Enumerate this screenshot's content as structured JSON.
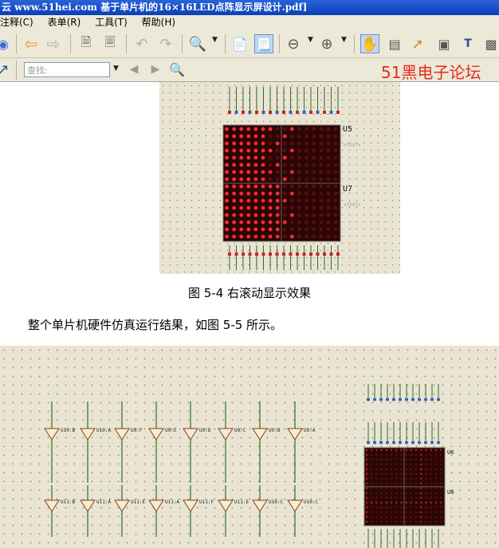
{
  "window": {
    "title": "云 www.51hei.com 基于单片机的16×16LED点阵显示屏设计.pdf]"
  },
  "menu": {
    "items": [
      "注释(C)",
      "表单(R)",
      "工具(T)",
      "帮助(H)"
    ]
  },
  "toolbar2": {
    "search_placeholder": "查找:",
    "brand": "51黑电子论坛"
  },
  "document": {
    "figure1": {
      "u5_label": "U5",
      "u7_label": "U7",
      "text_placeholder": "<TEXT>"
    },
    "caption": "图 5-4  右滚动显示效果",
    "paragraph": "整个单片机硬件仿真运行结果，如图     5-5 所示。",
    "figure2": {
      "inverters_top": [
        "U10:B",
        "U10:A",
        "U9:F",
        "U9:E",
        "U9:D",
        "U9:C",
        "U9:B",
        "U9:A"
      ],
      "inverters_bottom": [
        "U11:B",
        "U11:A",
        "U11:E",
        "U11:A",
        "U11:F",
        "U11:E",
        "U10:C",
        "U10:C"
      ],
      "u6_label": "U6",
      "u8_label": "U8"
    }
  },
  "colors": {
    "title_bar": "#0a3fb8",
    "toolbar_bg": "#ece9d8",
    "brand_red": "#e52b1c",
    "schematic_bg": "#e9e5d2",
    "led_on": "#ff2a2a",
    "led_off": "#5a0d0d"
  }
}
